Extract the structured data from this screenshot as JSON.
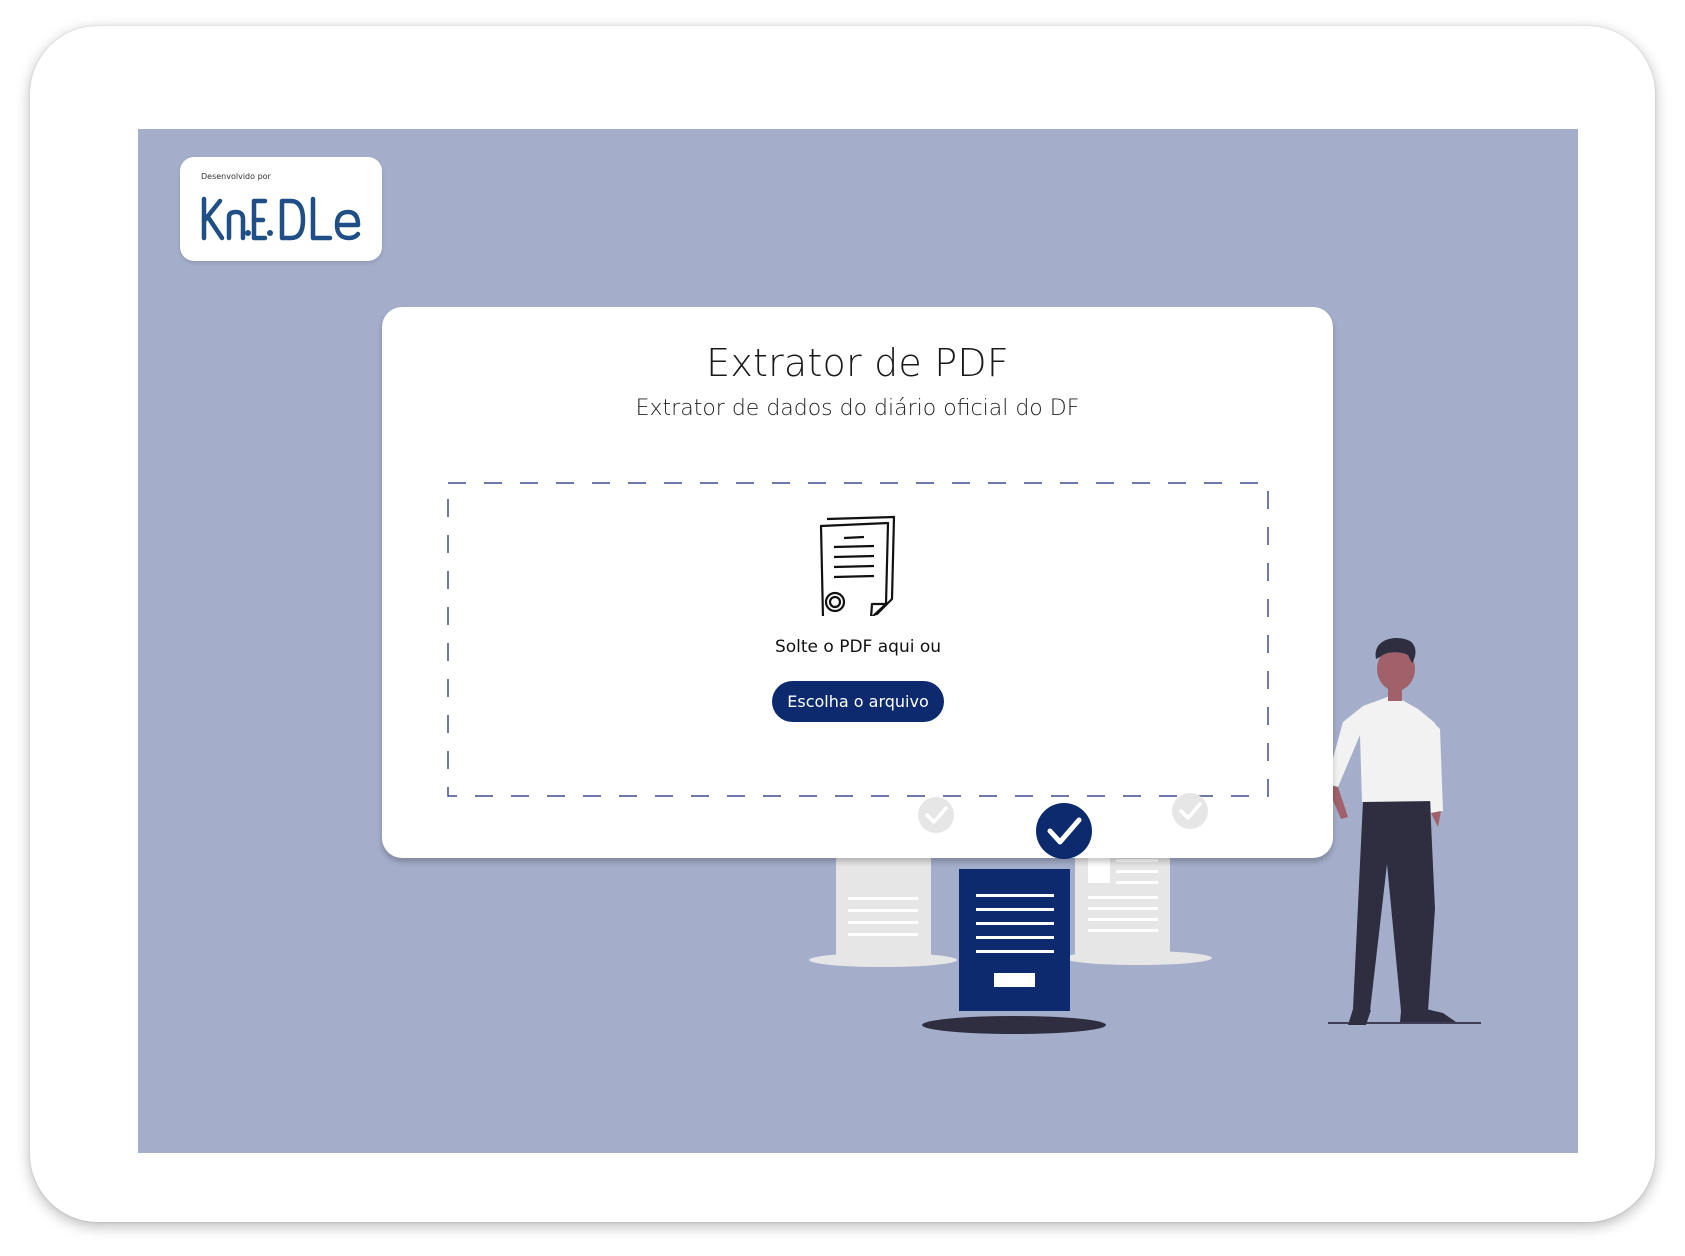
{
  "logo": {
    "caption": "Desenvolvido por",
    "brand": "KnEDLe"
  },
  "header": {
    "title": "Extrator de PDF",
    "subtitle": "Extrator de dados do diário oficial do DF"
  },
  "dropzone": {
    "prompt": "Solte o PDF aqui ou",
    "button_label": "Escolha o arquivo",
    "icon": "documents-icon"
  },
  "colors": {
    "background": "#a4aecb",
    "primary": "#0d2a6e",
    "card": "#ffffff",
    "border_dash": "#3a4f8a"
  },
  "illustration": {
    "icons": [
      "check-circle-icon",
      "document-icon",
      "person-illustration"
    ]
  }
}
